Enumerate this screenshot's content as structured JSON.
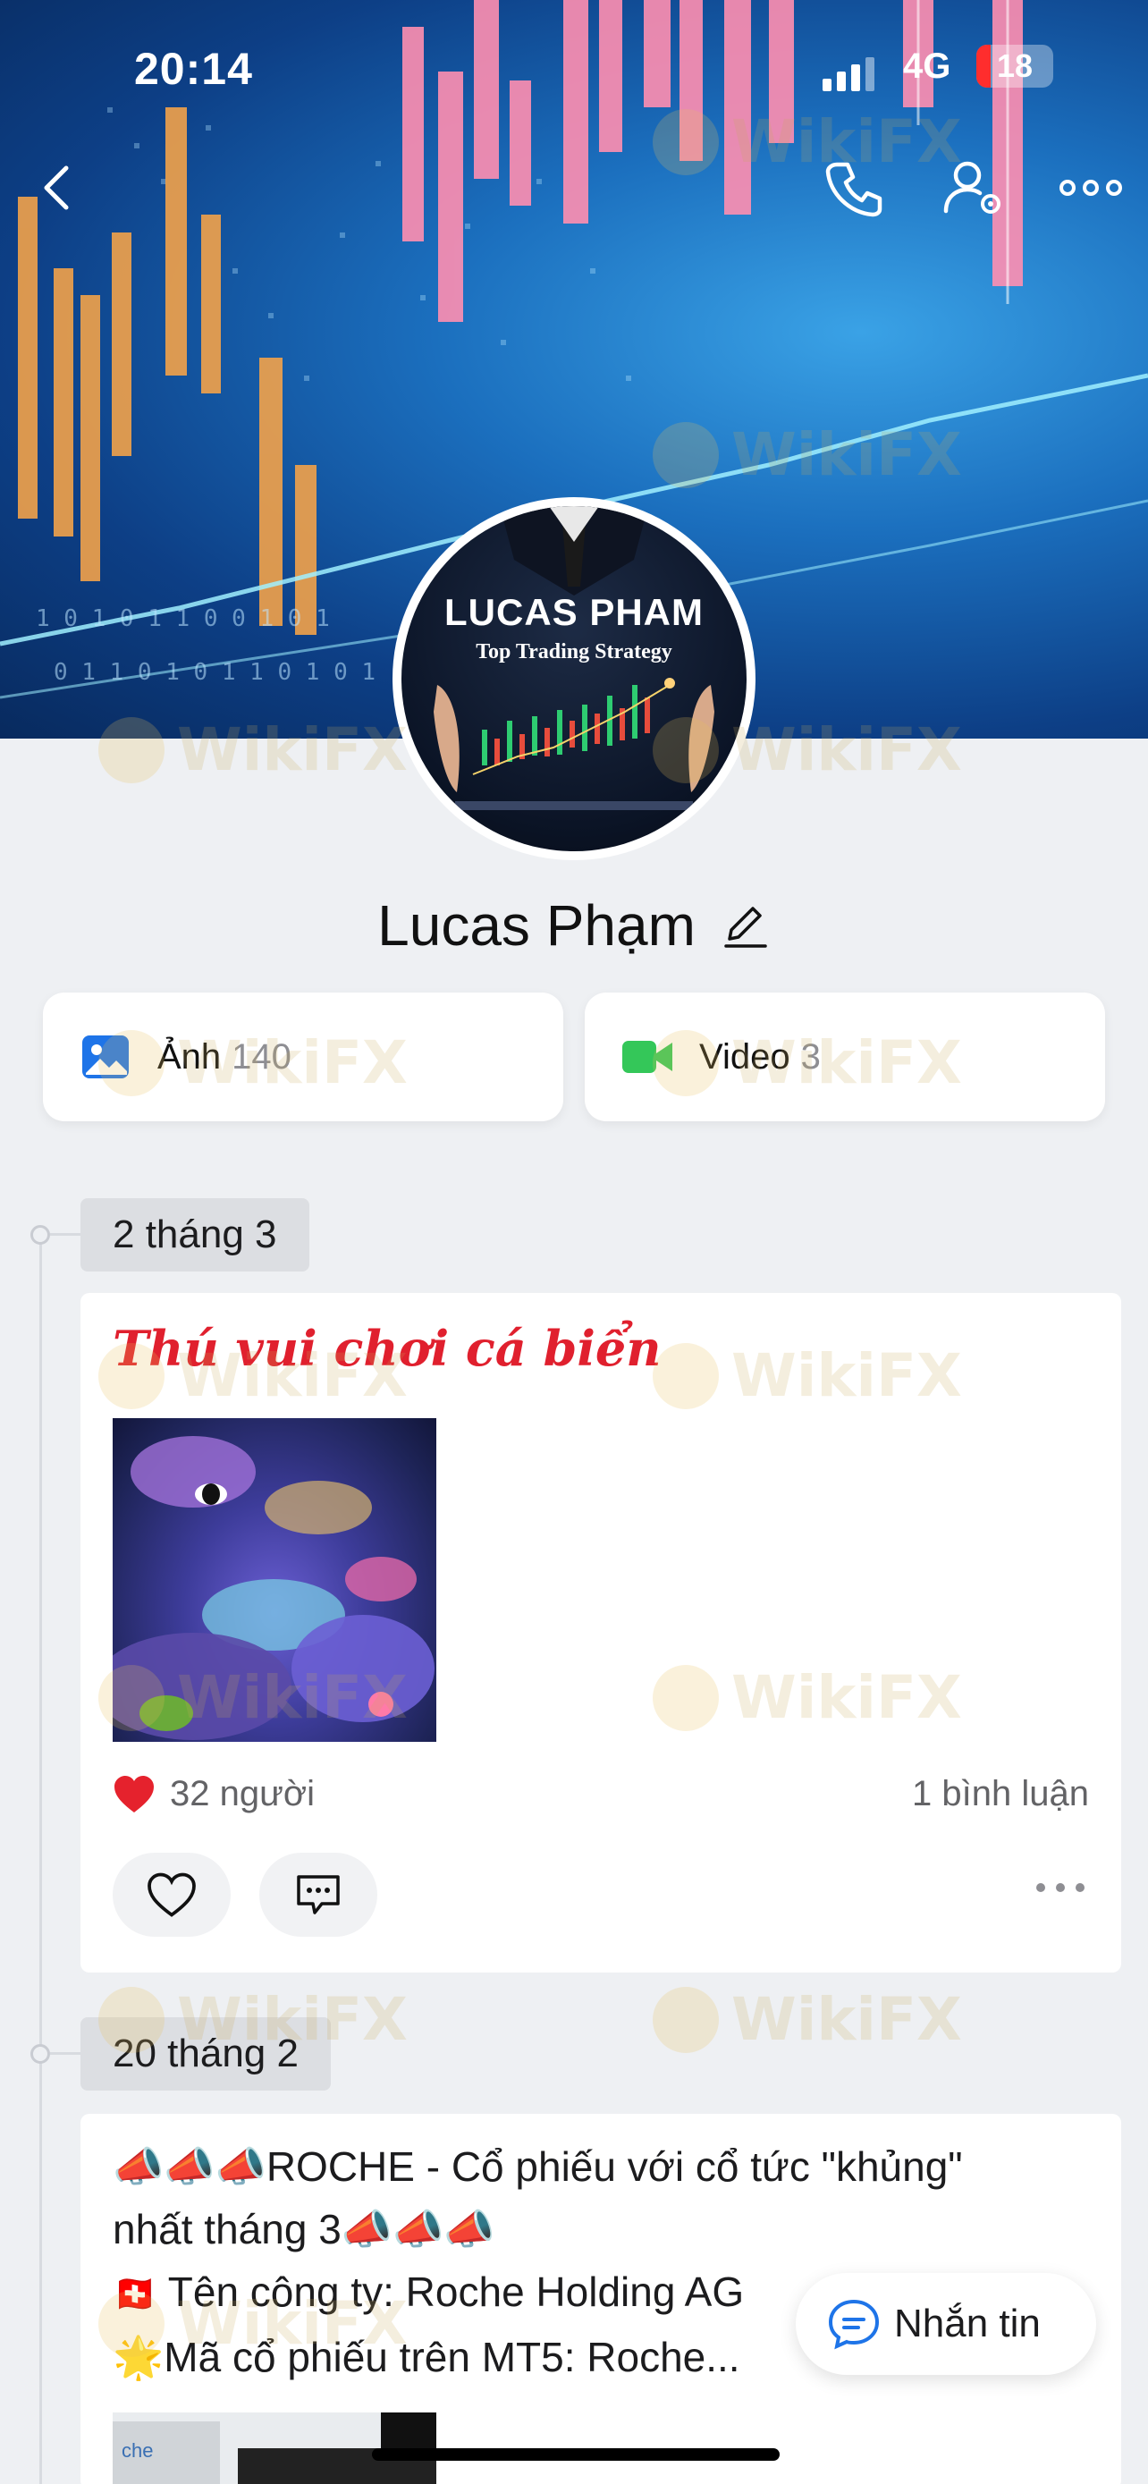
{
  "status_bar": {
    "time": "20:14",
    "network": "4G",
    "battery": "18"
  },
  "colors": {
    "accent_red": "#e0202e",
    "photo_blue": "#1e74e8",
    "video_green": "#34c759",
    "battery_red": "#ff2d2d"
  },
  "header_icons": [
    "back-icon",
    "phone-icon",
    "profile-settings-icon",
    "more-icon"
  ],
  "avatar": {
    "title": "LUCAS PHAM",
    "subtitle": "Top Trading Strategy"
  },
  "profile": {
    "name": "Lucas Phạm"
  },
  "media": {
    "photos": {
      "label": "Ảnh",
      "count": "140"
    },
    "videos": {
      "label": "Video",
      "count": "3"
    }
  },
  "timeline": [
    {
      "date": "2 tháng 3",
      "title": "Thú vui chơi cá biển",
      "likes": "32 người",
      "comments": "1 bình luận"
    },
    {
      "date": "20 tháng 2",
      "line1": "📣📣📣ROCHE - Cổ phiếu với cổ tức \"khủng\"",
      "line2": "nhất tháng 3📣📣📣",
      "line3_flag": "🇨🇭",
      "line3": "Tên công ty: Roche Holding AG",
      "line4_star": "🌟",
      "line4": "Mã cổ phiếu trên MT5: Roche..."
    }
  ],
  "message_button": {
    "label": "Nhắn tin"
  },
  "watermark": "WikiFX"
}
